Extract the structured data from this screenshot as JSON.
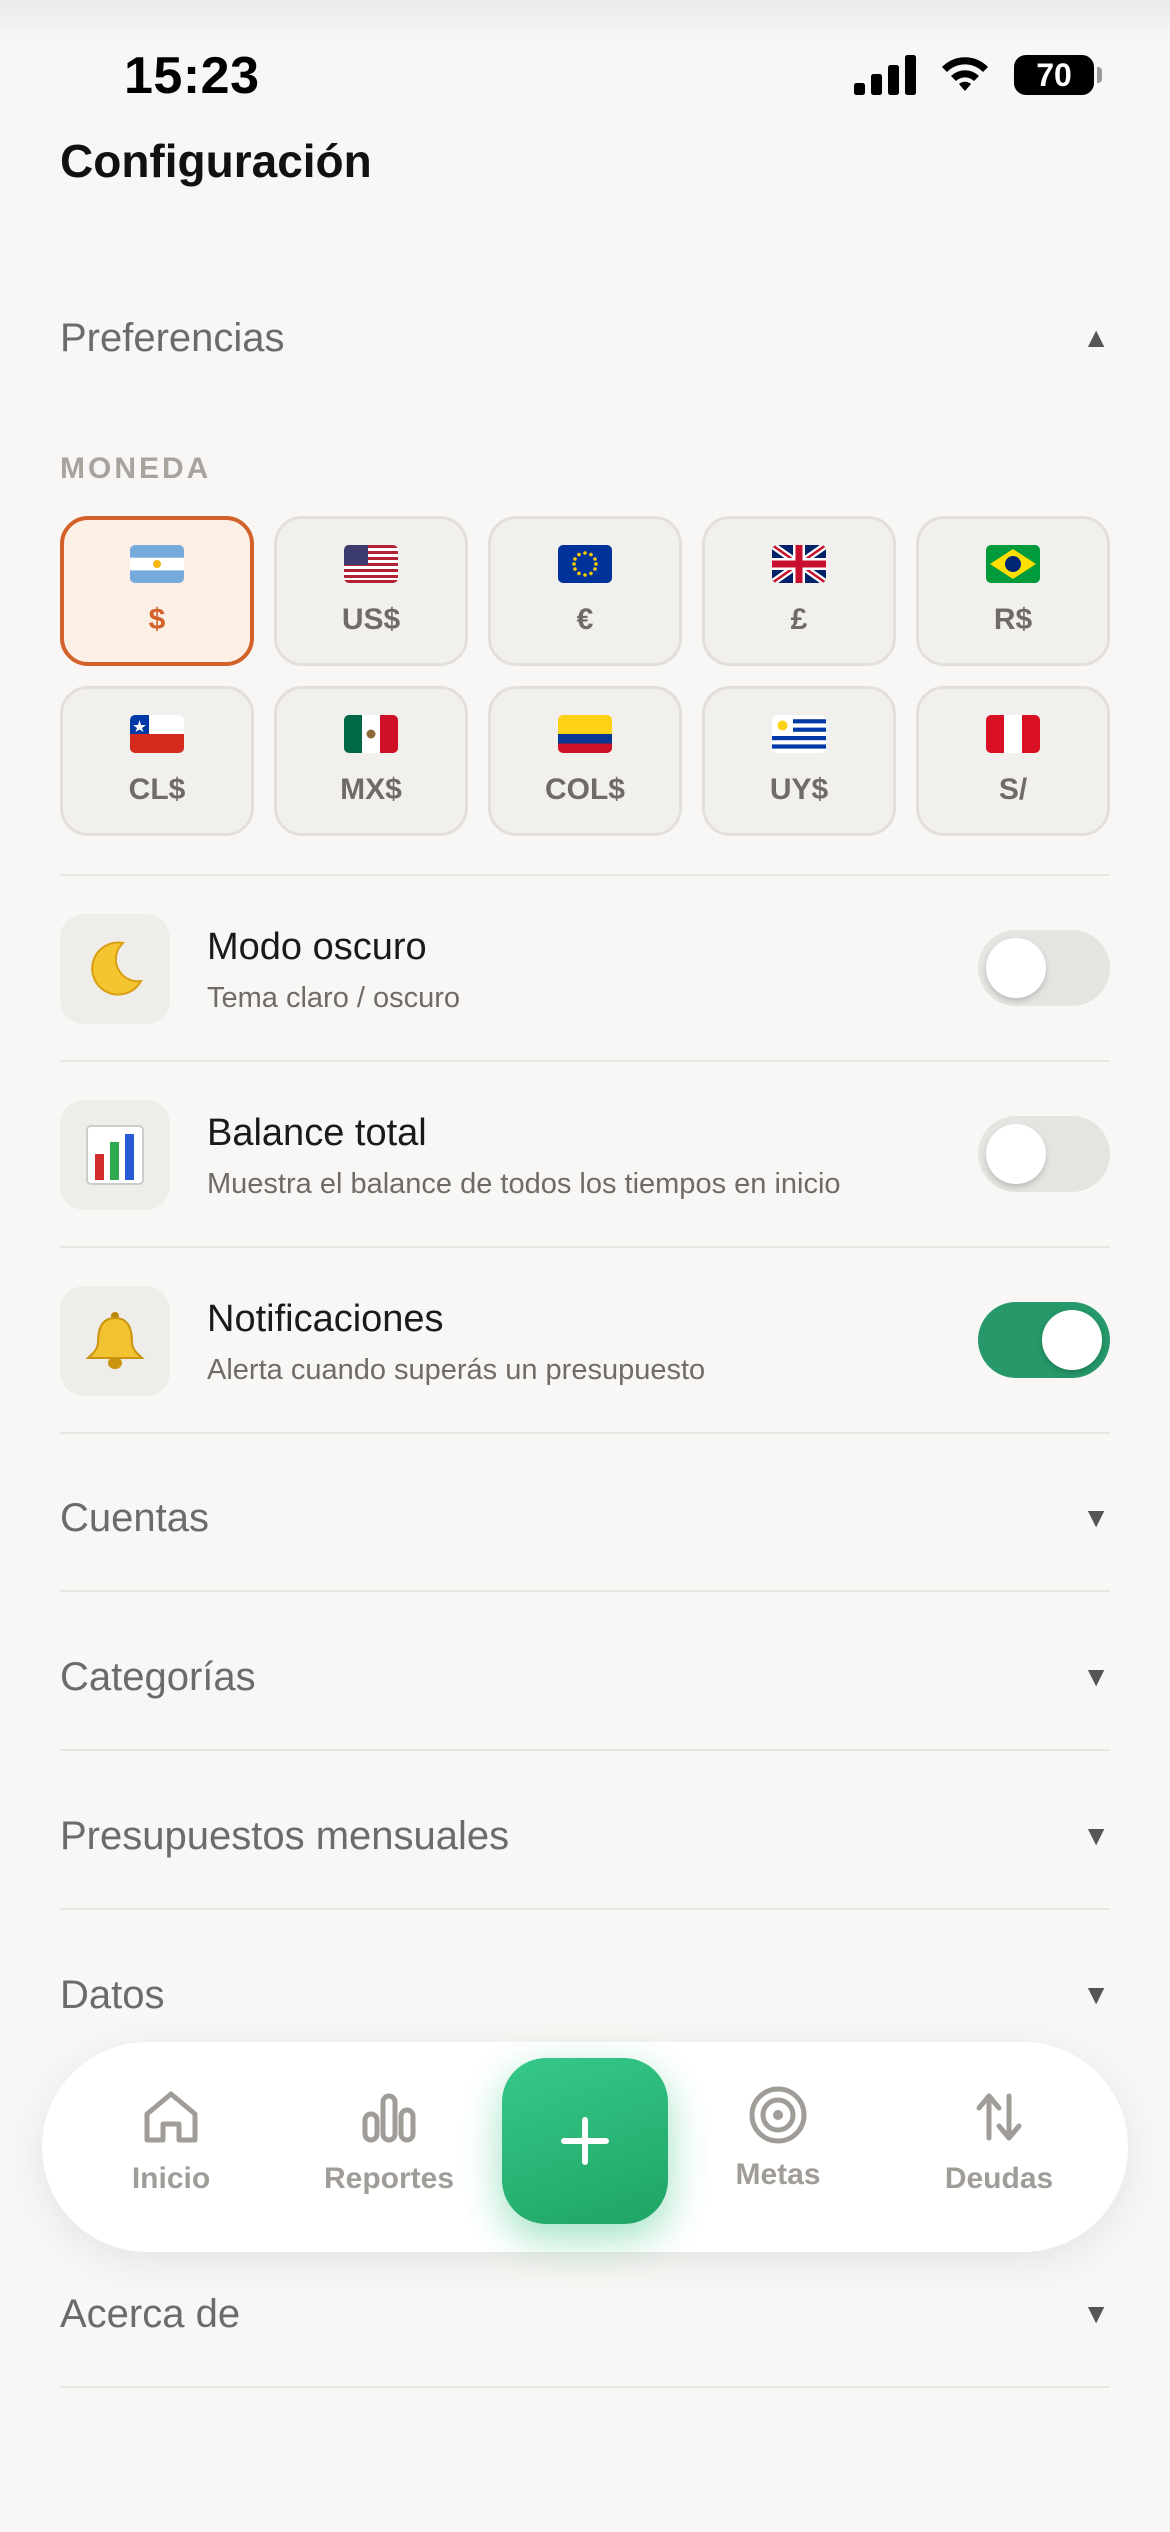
{
  "status_bar": {
    "time": "15:23",
    "battery": "70"
  },
  "page": {
    "title": "Configuración"
  },
  "preferences": {
    "title": "Preferencias",
    "arrow": "▲",
    "currency_label": "MONEDA",
    "currencies": [
      {
        "code": "$",
        "flag": "argentina-flag",
        "selected": true
      },
      {
        "code": "US$",
        "flag": "usa-flag"
      },
      {
        "code": "€",
        "flag": "eu-flag"
      },
      {
        "code": "£",
        "flag": "uk-flag"
      },
      {
        "code": "R$",
        "flag": "brazil-flag"
      },
      {
        "code": "CL$",
        "flag": "chile-flag"
      },
      {
        "code": "MX$",
        "flag": "mexico-flag"
      },
      {
        "code": "COL$",
        "flag": "colombia-flag"
      },
      {
        "code": "UY$",
        "flag": "uruguay-flag"
      },
      {
        "code": "S/",
        "flag": "peru-flag"
      }
    ],
    "toggles": [
      {
        "title": "Modo oscuro",
        "subtitle": "Tema claro / oscuro",
        "icon": "crescent-moon-icon",
        "on": false
      },
      {
        "title": "Balance total",
        "subtitle": "Muestra el balance de todos los tiempos en inicio",
        "icon": "bar-chart-icon",
        "on": false
      },
      {
        "title": "Notificaciones",
        "subtitle": "Alerta cuando superás un presupuesto",
        "icon": "bell-icon",
        "on": true
      }
    ]
  },
  "sections": [
    {
      "title": "Cuentas",
      "arrow": "▼"
    },
    {
      "title": "Categorías",
      "arrow": "▼"
    },
    {
      "title": "Presupuestos mensuales",
      "arrow": "▼"
    },
    {
      "title": "Datos",
      "arrow": "▼"
    },
    {
      "title": "Acerca de",
      "arrow": "▼"
    }
  ],
  "nav": {
    "items": [
      {
        "label": "Inicio",
        "icon": "home-icon"
      },
      {
        "label": "Reportes",
        "icon": "reports-icon"
      },
      {
        "label": "Metas",
        "icon": "target-icon"
      },
      {
        "label": "Deudas",
        "icon": "transfer-arrows-icon"
      }
    ],
    "fab_icon": "plus-icon"
  },
  "colors": {
    "background": "#f8f7f5",
    "accent": "#d2622a",
    "toggle_on": "#269869",
    "fab": "#2bb877"
  }
}
